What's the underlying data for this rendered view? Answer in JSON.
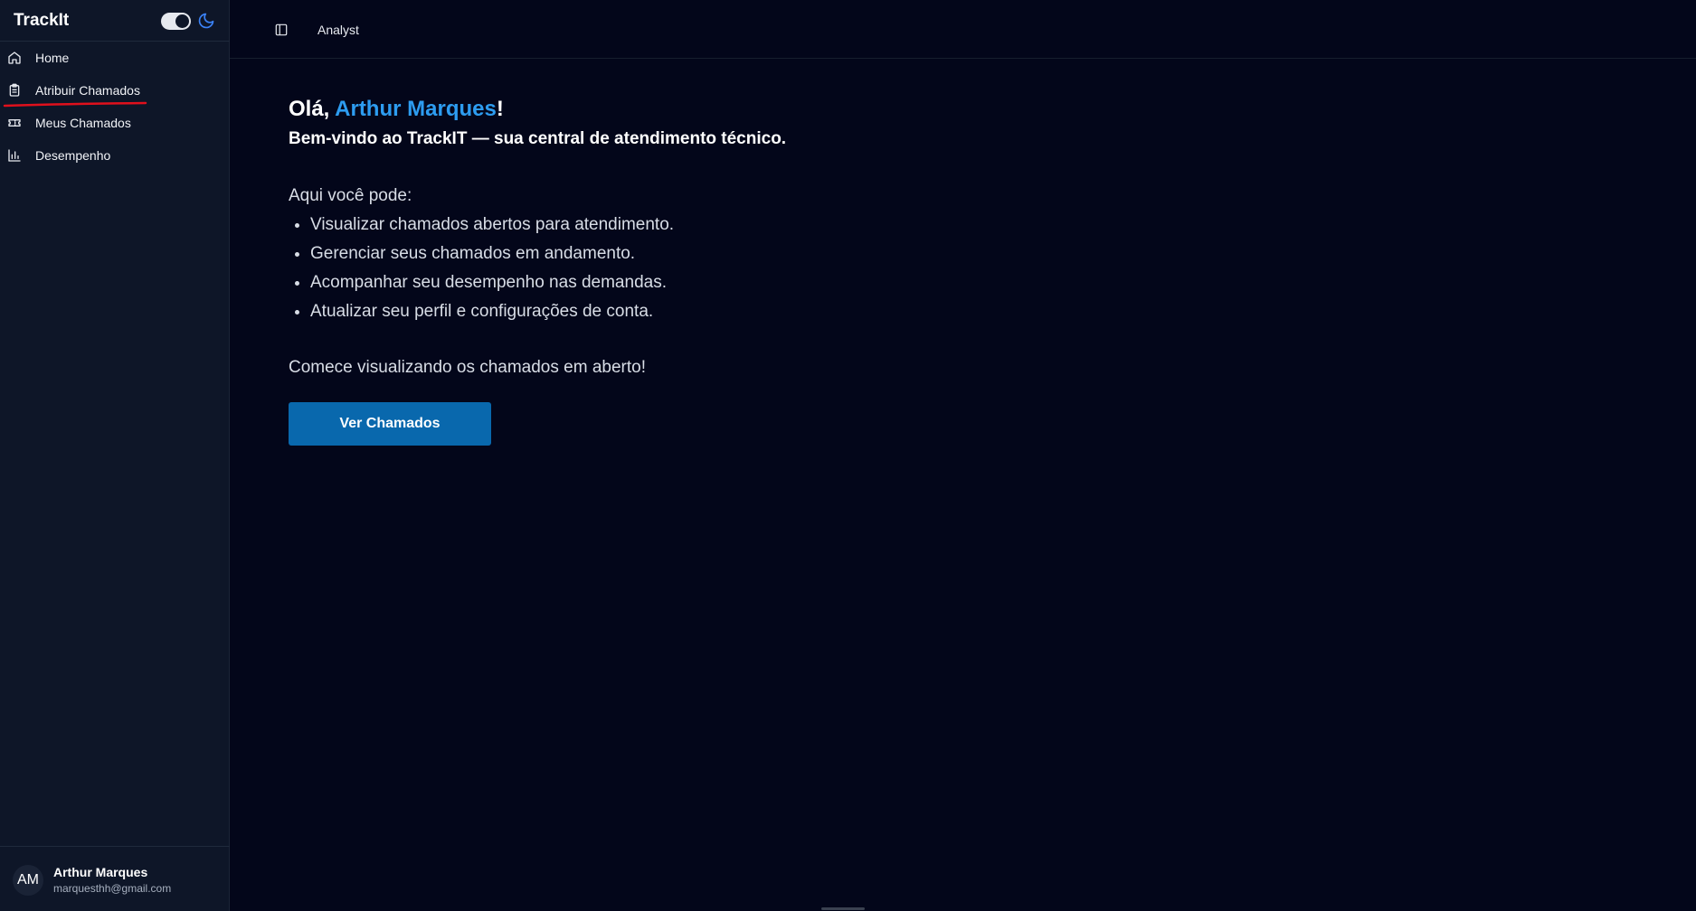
{
  "sidebar": {
    "brand": "TrackIt",
    "theme_toggle": {
      "state": "on",
      "mode_icon": "moon-icon"
    },
    "items": [
      {
        "label": "Home",
        "icon": "home-icon"
      },
      {
        "label": "Atribuir Chamados",
        "icon": "clipboard-icon",
        "active": true
      },
      {
        "label": "Meus Chamados",
        "icon": "ticket-icon"
      },
      {
        "label": "Desempenho",
        "icon": "bar-chart-icon"
      }
    ],
    "user": {
      "initials": "AM",
      "name": "Arthur Marques",
      "email": "marquesthh@gmail.com"
    }
  },
  "topbar": {
    "panel_icon": "sidebar-panel-icon",
    "breadcrumb": "Analyst"
  },
  "main": {
    "greeting_prefix": "Olá, ",
    "greeting_name": "Arthur Marques",
    "greeting_suffix": "!",
    "subtitle": "Bem-vindo ao TrackIT — sua central de atendimento técnico.",
    "intro": "Aqui você pode:",
    "features": [
      "Visualizar chamados abertos para atendimento.",
      "Gerenciar seus chamados em andamento.",
      "Acompanhar seu desempenho nas demandas.",
      "Atualizar seu perfil e configurações de conta."
    ],
    "cta_text": "Comece visualizando os chamados em aberto!",
    "cta_button": "Ver Chamados"
  },
  "colors": {
    "background": "#03061a",
    "sidebar": "#0e1628",
    "accent": "#2d9cf0",
    "button": "#0968ad",
    "annotation": "#e0101c"
  }
}
